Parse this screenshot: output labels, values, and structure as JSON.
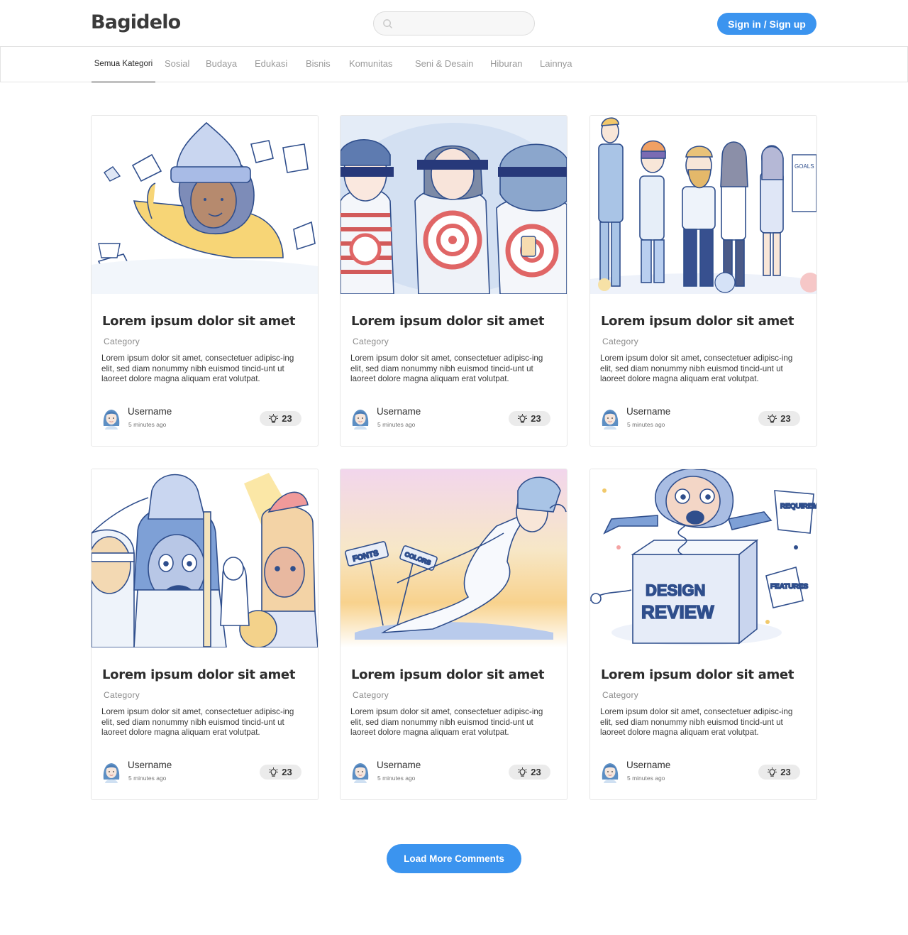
{
  "header": {
    "logo": "Bagidelo",
    "search": {
      "placeholder": "",
      "value": ""
    },
    "signin_label": "Sign in / Sign up"
  },
  "categories": [
    {
      "label": "Semua Kategori",
      "active": true
    },
    {
      "label": "Sosial"
    },
    {
      "label": "Budaya"
    },
    {
      "label": "Edukasi"
    },
    {
      "label": "Bisnis"
    },
    {
      "label": "Komunitas"
    },
    {
      "label": "Seni & Desain"
    },
    {
      "label": "Hiburan"
    },
    {
      "label": "Lainnya"
    }
  ],
  "cards": [
    {
      "illustration": "girl-in-beanie-drawing",
      "title": "Lorem ipsum dolor sit amet",
      "category": "Category",
      "desc": "Lorem ipsum dolor sit amet, consectetuer adipisc-ing elit, sed diam nonummy nibh euismod tincid-unt ut laoreet dolore magna aliquam erat volutpat.",
      "username": "Username",
      "time": "5 minutes ago",
      "likes": "23"
    },
    {
      "illustration": "blindfolded-people-with-targets",
      "title": "Lorem ipsum dolor sit amet",
      "category": "Category",
      "desc": "Lorem ipsum dolor sit amet, consectetuer adipisc-ing elit, sed diam nonummy nibh euismod tincid-unt ut laoreet dolore magna aliquam erat volutpat.",
      "username": "Username",
      "time": "5 minutes ago",
      "likes": "23"
    },
    {
      "illustration": "office-party-group",
      "title": "Lorem ipsum dolor sit amet",
      "category": "Category",
      "desc": "Lorem ipsum dolor sit amet, consectetuer adipisc-ing elit, sed diam nonummy nibh euismod tincid-unt ut laoreet dolore magna aliquam erat volutpat.",
      "username": "Username",
      "time": "5 minutes ago",
      "likes": "23"
    },
    {
      "illustration": "spartan-warriors",
      "title": "Lorem ipsum dolor sit amet",
      "category": "Category",
      "desc": "Lorem ipsum dolor sit amet, consectetuer adipisc-ing elit, sed diam nonummy nibh euismod tincid-unt ut laoreet dolore magna aliquam erat volutpat.",
      "username": "Username",
      "time": "5 minutes ago",
      "likes": "23"
    },
    {
      "illustration": "leaping-warrior-with-signposts",
      "title": "Lorem ipsum dolor sit amet",
      "category": "Category",
      "desc": "Lorem ipsum dolor sit amet, consectetuer adipisc-ing elit, sed diam nonummy nibh euismod tincid-unt ut laoreet dolore magna aliquam erat volutpat.",
      "username": "Username",
      "time": "5 minutes ago",
      "likes": "23"
    },
    {
      "illustration": "jack-in-the-box-design-review",
      "title": "Lorem ipsum dolor sit amet",
      "category": "Category",
      "desc": "Lorem ipsum dolor sit amet, consectetuer adipisc-ing elit, sed diam nonummy nibh euismod tincid-unt ut laoreet dolore magna aliquam erat volutpat.",
      "username": "Username",
      "time": "5 minutes ago",
      "likes": "23"
    }
  ],
  "illustration_text": {
    "goals": "GOALS",
    "fonts": "FONTS",
    "colors": "COLORS",
    "design": "DESIGN",
    "review": "REVIEW",
    "requirements": "REQUIREMENTS",
    "features": "FEATURES"
  },
  "load_more_label": "Load More Comments",
  "colors": {
    "accent": "#3b94ef",
    "border": "#e6e6e6",
    "muted": "#9a9a9a",
    "badge_bg": "#ebebeb"
  }
}
